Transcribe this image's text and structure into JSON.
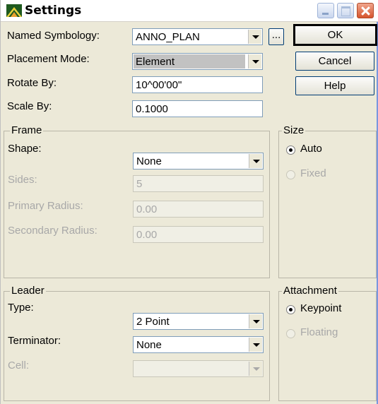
{
  "window": {
    "title": "Settings"
  },
  "colors": {
    "background": "#ece9d8",
    "field_border": "#7f9db9",
    "disabled_text": "#a8a8a8"
  },
  "icons": [
    "app-icon",
    "minimize-icon",
    "maximize-icon",
    "close-icon",
    "chevron-down-icon",
    "radio-icon"
  ],
  "fields": {
    "named_symbology": {
      "label": "Named Symbology:",
      "value": "ANNO_PLAN",
      "browse": "..."
    },
    "placement_mode": {
      "label": "Placement Mode:",
      "value": "Element"
    },
    "rotate_by": {
      "label": "Rotate By:",
      "value": "10^00'00\""
    },
    "scale_by": {
      "label": "Scale By:",
      "value": "0.1000"
    }
  },
  "buttons": {
    "ok": "OK",
    "cancel": "Cancel",
    "help": "Help"
  },
  "frame": {
    "title": "Frame",
    "shape": {
      "label": "Shape:",
      "value": "None"
    },
    "sides": {
      "label": "Sides:",
      "value": "5"
    },
    "primary_radius": {
      "label": "Primary Radius:",
      "value": "0.00"
    },
    "secondary_radius": {
      "label": "Secondary Radius:",
      "value": "0.00"
    }
  },
  "size": {
    "title": "Size",
    "auto": "Auto",
    "fixed": "Fixed",
    "selected": "Auto"
  },
  "leader": {
    "title": "Leader",
    "type": {
      "label": "Type:",
      "value": "2 Point"
    },
    "terminator": {
      "label": "Terminator:",
      "value": "None"
    },
    "cell": {
      "label": "Cell:",
      "value": ""
    }
  },
  "attachment": {
    "title": "Attachment",
    "keypoint": "Keypoint",
    "floating": "Floating",
    "selected": "Keypoint"
  }
}
